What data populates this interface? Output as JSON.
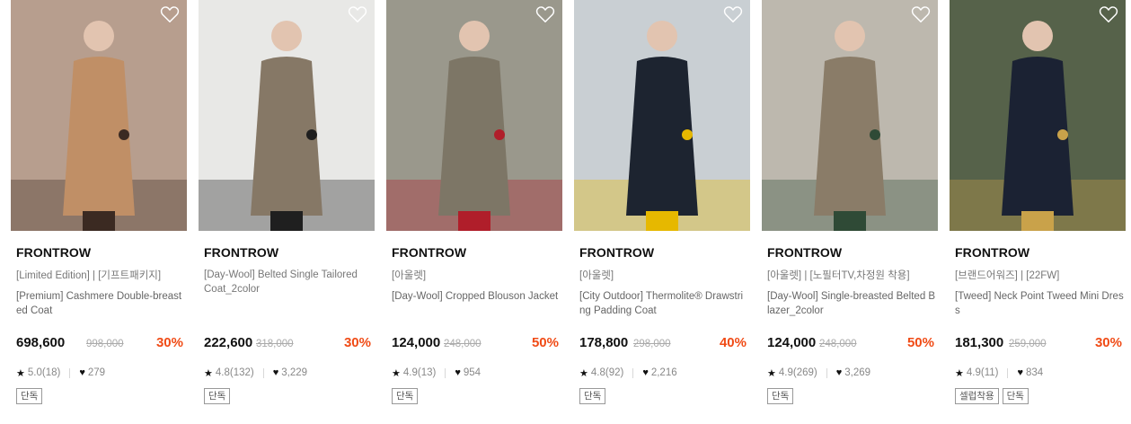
{
  "products": [
    {
      "brand": "FRONTROW",
      "tag": "[Limited Edition] | [기프트패키지]",
      "title": "[Premium] Cashmere Double-breasted Coat",
      "price": "698,600",
      "original": "998,000",
      "discount": "30%",
      "rating": "5.0(18)",
      "likes": "279",
      "badges": [
        "단독"
      ],
      "colors": {
        "bg": "#b79e8e",
        "main": "#c08f66",
        "accent": "#3b2a22"
      }
    },
    {
      "brand": "FRONTROW",
      "tag": "[Day-Wool] Belted Single Tailored Coat_2color",
      "title": "",
      "price": "222,600",
      "original": "318,000",
      "discount": "30%",
      "rating": "4.8(132)",
      "likes": "3,229",
      "badges": [
        "단독"
      ],
      "colors": {
        "bg": "#e8e8e6",
        "main": "#867866",
        "accent": "#1f1f1f"
      }
    },
    {
      "brand": "FRONTROW",
      "tag": "[아울렛]",
      "title": "[Day-Wool] Cropped Blouson Jacket",
      "price": "124,000",
      "original": "248,000",
      "discount": "50%",
      "rating": "4.9(13)",
      "likes": "954",
      "badges": [
        "단독"
      ],
      "colors": {
        "bg": "#9a988c",
        "main": "#7d7666",
        "accent": "#b01e2a"
      }
    },
    {
      "brand": "FRONTROW",
      "tag": "[아울렛]",
      "title": "[City Outdoor] Thermolite® Drawstring Padding Coat",
      "price": "178,800",
      "original": "298,000",
      "discount": "40%",
      "rating": "4.8(92)",
      "likes": "2,216",
      "badges": [
        "단독"
      ],
      "colors": {
        "bg": "#c9cfd3",
        "main": "#1d2430",
        "accent": "#e6b800"
      }
    },
    {
      "brand": "FRONTROW",
      "tag": "[아울렛] | [노필터TV,차정원 착용]",
      "title": "[Day-Wool] Single-breasted Belted Blazer_2color",
      "price": "124,000",
      "original": "248,000",
      "discount": "50%",
      "rating": "4.9(269)",
      "likes": "3,269",
      "badges": [
        "단독"
      ],
      "colors": {
        "bg": "#bdb8ae",
        "main": "#8a7c68",
        "accent": "#2f4a36"
      }
    },
    {
      "brand": "FRONTROW",
      "tag": "[브랜드어워즈] | [22FW]",
      "title": "[Tweed] Neck Point Tweed Mini Dress",
      "price": "181,300",
      "original": "259,000",
      "discount": "30%",
      "rating": "4.9(11)",
      "likes": "834",
      "badges": [
        "셀럽착용",
        "단독"
      ],
      "colors": {
        "bg": "#56624a",
        "main": "#1b2233",
        "accent": "#c9a24a"
      }
    }
  ]
}
